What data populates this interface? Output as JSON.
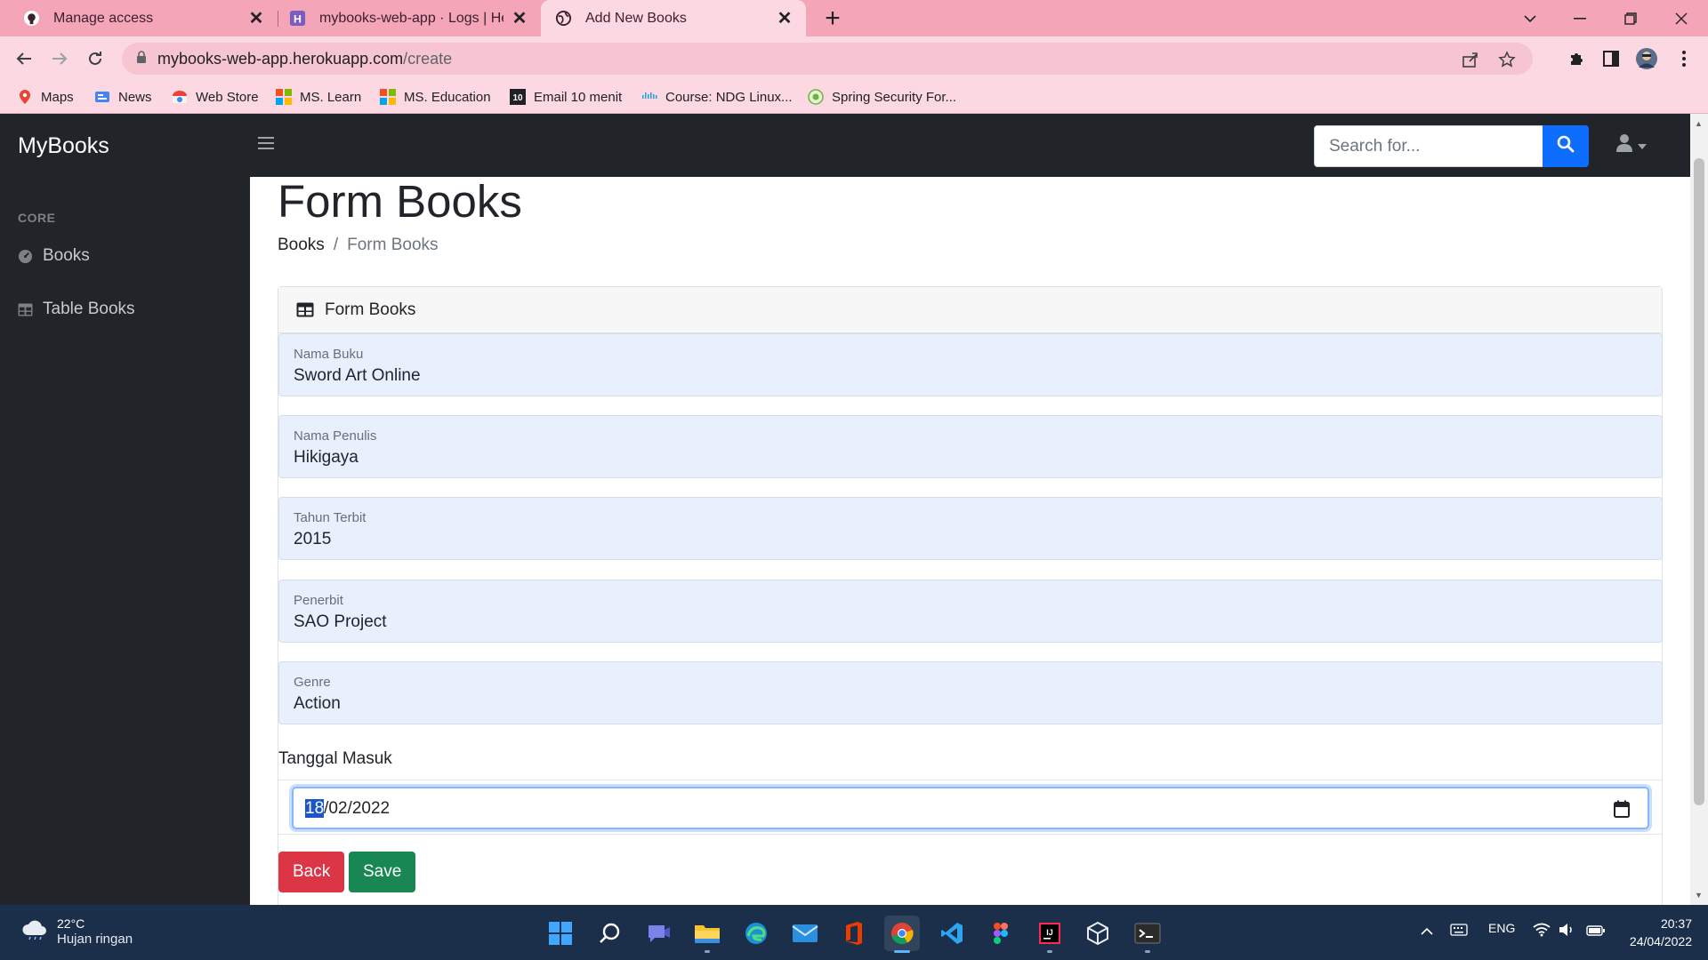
{
  "browser": {
    "tabs": [
      {
        "title": "Manage access",
        "icon": "github-icon"
      },
      {
        "title": "mybooks-web-app · Logs | Herok",
        "icon": "heroku-icon"
      },
      {
        "title": "Add New Books",
        "icon": "globe-icon",
        "active": true
      }
    ],
    "url_host": "mybooks-web-app.herokuapp.com",
    "url_path": "/create",
    "bookmarks": [
      {
        "label": "Maps",
        "icon": "maps-icon"
      },
      {
        "label": "News",
        "icon": "news-icon"
      },
      {
        "label": "Web Store",
        "icon": "webstore-icon"
      },
      {
        "label": "MS. Learn",
        "icon": "microsoft-icon"
      },
      {
        "label": "MS. Education",
        "icon": "microsoft-icon"
      },
      {
        "label": "Email 10 menit",
        "icon": "email10-icon"
      },
      {
        "label": "Course: NDG Linux...",
        "icon": "cisco-icon"
      },
      {
        "label": "Spring Security For...",
        "icon": "spring-icon"
      }
    ]
  },
  "app": {
    "brand": "MyBooks",
    "search_placeholder": "Search for...",
    "sidebar": {
      "heading": "CORE",
      "items": [
        {
          "label": "Books",
          "icon": "tachometer-icon"
        },
        {
          "label": "Table Books",
          "icon": "table-icon"
        }
      ]
    },
    "page_title": "Form Books",
    "breadcrumb": {
      "link": "Books",
      "separator": "/",
      "active": "Form Books"
    },
    "card_title": "Form Books",
    "fields": [
      {
        "label": "Nama Buku",
        "value": "Sword Art Online"
      },
      {
        "label": "Nama Penulis",
        "value": "Hikigaya"
      },
      {
        "label": "Tahun Terbit",
        "value": "2015"
      },
      {
        "label": "Penerbit",
        "value": "SAO Project"
      },
      {
        "label": "Genre",
        "value": "Action"
      }
    ],
    "date": {
      "label": "Tanggal Masuk",
      "selected_part": "18",
      "rest": "/02/2022"
    },
    "buttons": {
      "back": "Back",
      "save": "Save"
    }
  },
  "taskbar": {
    "weather_temp": "22°C",
    "weather_cond": "Hujan ringan",
    "language": "ENG",
    "time": "20:37",
    "date": "24/04/2022"
  },
  "colors": {
    "tab_strip": "#f4a6b8",
    "toolbar": "#fcd8e2",
    "nav_dark": "#212529",
    "primary": "#0d6efd",
    "danger": "#dc3545",
    "success": "#198754",
    "autofill": "#e8f0fd",
    "taskbar": "#1b2e4a"
  }
}
